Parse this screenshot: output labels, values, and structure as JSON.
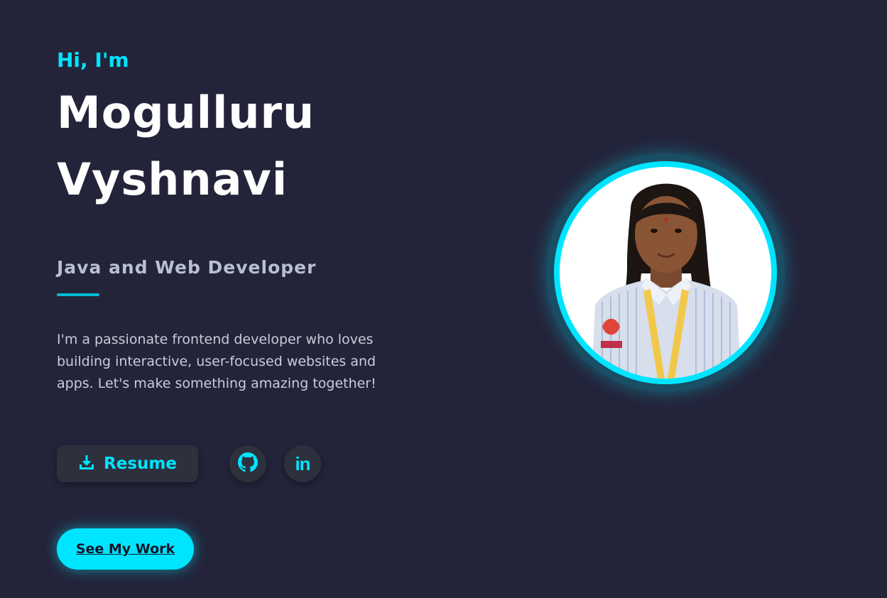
{
  "hero": {
    "greeting": "Hi, I'm",
    "name_line1": "Mogulluru",
    "name_line2": "Vyshnavi",
    "role": "Java and Web Developer",
    "bio": "I'm a passionate frontend developer who loves building interactive, user-focused websites and apps. Let's make something amazing together!"
  },
  "actions": {
    "resume_label": "Resume",
    "resume_icon": "download-icon",
    "github_icon": "github-icon",
    "linkedin_icon": "linkedin-icon",
    "linkedin_glyph": "in",
    "work_label": "See My Work"
  },
  "profile": {
    "photo_icon": "profile-photo"
  },
  "colors": {
    "background": "#23243a",
    "accent": "#00e5ff",
    "button_bg": "#2d303d",
    "text_primary": "#ffffff",
    "text_secondary": "#c8cdd8"
  }
}
